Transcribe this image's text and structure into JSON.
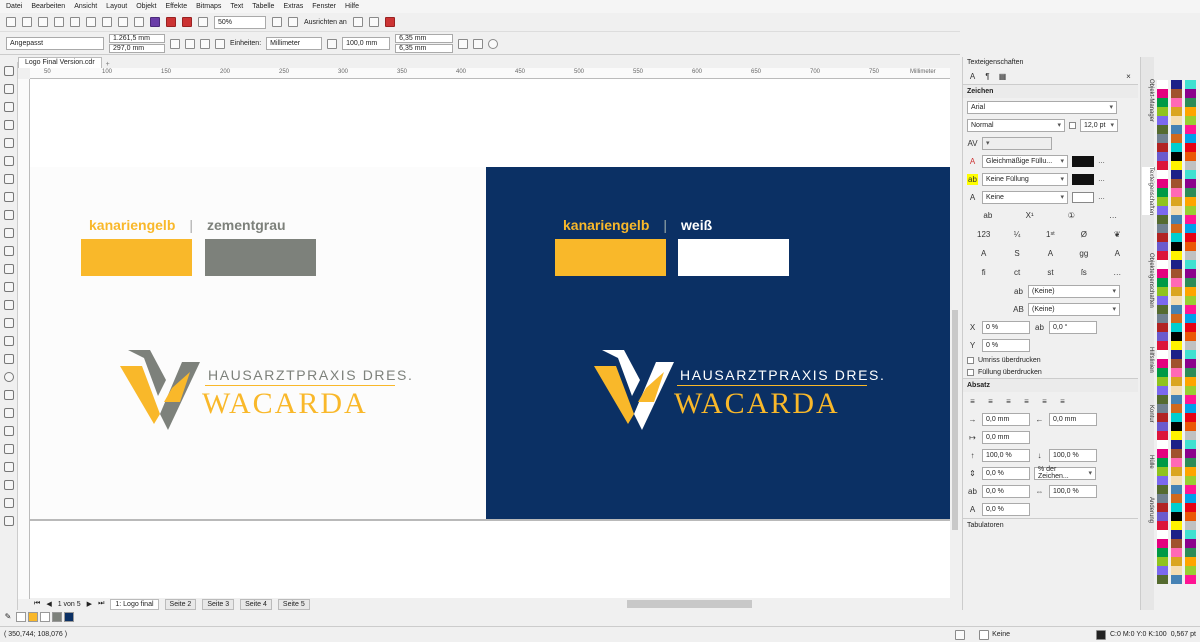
{
  "menu": [
    "Datei",
    "Bearbeiten",
    "Ansicht",
    "Layout",
    "Objekt",
    "Effekte",
    "Bitmaps",
    "Text",
    "Tabelle",
    "Extras",
    "Fenster",
    "Hilfe"
  ],
  "toolbar": {
    "zoom": "50%",
    "snap": "Ausrichten an"
  },
  "propbar": {
    "preset": "Angepasst",
    "width": "1.261,5 mm",
    "height": "297,0 mm",
    "units_label": "Einheiten:",
    "units": "Millimeter",
    "nudge": "100,0 mm",
    "dup_x": "6,35 mm",
    "dup_y": "6,35 mm"
  },
  "document_tab": "Logo Final Version.cdr",
  "ruler_labels": [
    "50",
    "100",
    "150",
    "200",
    "250",
    "300",
    "350",
    "400",
    "450",
    "500",
    "550",
    "600",
    "650",
    "700",
    "750",
    "Millimeter"
  ],
  "canvas": {
    "left": {
      "label_a": "kanariengelb",
      "sep": "|",
      "label_b": "zementgrau",
      "color_a": "#f9b82a",
      "color_b": "#7d817b"
    },
    "right": {
      "label_a": "kanariengelb",
      "sep": "|",
      "label_b": "weiß",
      "color_a": "#f9b82a",
      "color_b": "#ffffff",
      "background": "#0b3064"
    },
    "logo": {
      "line1": "HAUSARZTPRAXIS DRES.",
      "line2": "WACARDA",
      "gold": "#f9b82a",
      "grey": "#7d817b"
    }
  },
  "pagebar": {
    "counter": "1 von 5",
    "pages": [
      "1: Logo final",
      "Seite 2",
      "Seite 3",
      "Seite 4",
      "Seite 5"
    ]
  },
  "status": {
    "coords": "( 350,744; 108,076 )",
    "fill": "Keine",
    "color_info": "C:0 M:0 Y:0 K:100",
    "outline": "0,567 pt"
  },
  "panel": {
    "title": "Texteigenschaften",
    "char_section": "Zeichen",
    "font": "Arial",
    "style": "Normal",
    "size": "12,0 pt",
    "fill_type": "Gleichmäßige Füllu...",
    "bg_fill": "Keine Füllung",
    "outline": "Keine",
    "strike": "(Keine)",
    "underline": "(Keine)",
    "kerning": "0 %",
    "angle": "0,0 °",
    "y_shift": "0 %",
    "overprint_outline": "Umriss überdrucken",
    "overprint_fill": "Füllung überdrucken",
    "para_section": "Absatz",
    "indent_left": "0,0 mm",
    "indent_right": "0,0 mm",
    "indent_first": "0,0 mm",
    "spacing_before": "100,0 %",
    "spacing_after": "100,0 %",
    "line_spacing": "0,0 %",
    "line_unit": "% der Zeichen...",
    "char_spacing": "0,0 %",
    "word_spacing": "100,0 %",
    "lang_spacing": "0,0 %",
    "tabs_section": "Tabulatoren",
    "side_tabs": [
      "Objekt-Manager",
      "Texteigenschaften",
      "Objekteigenschaften",
      "Hilfslinien",
      "Kontur",
      "Hülle",
      "Änderung"
    ]
  }
}
